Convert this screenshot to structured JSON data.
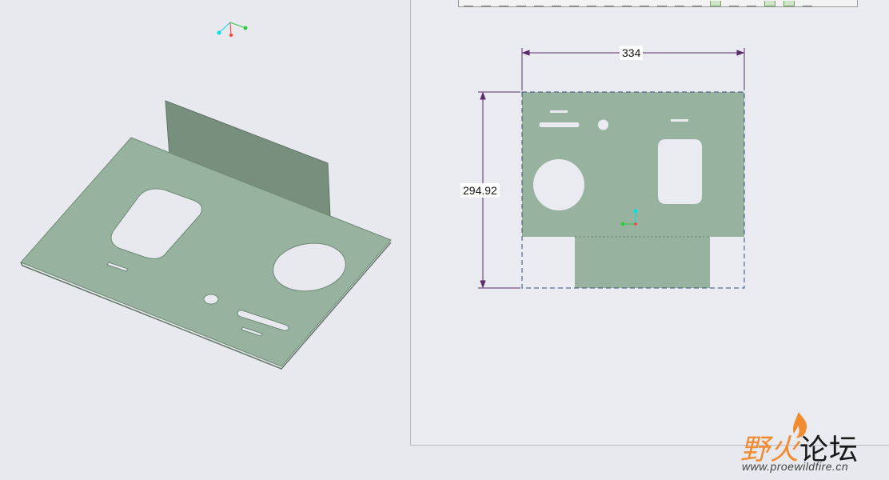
{
  "colors": {
    "background": "#e8e9ee",
    "sheet_face": "#97b29e",
    "sheet_wall": "#788f7e",
    "dimension_line": "#5a2d6b",
    "boundary_dash": "#2d4f7a",
    "csys_x": "#2ecc40",
    "csys_y": "#00e0e0",
    "csys_z": "#ff3b3b",
    "watermark_orange": "#f28a2e"
  },
  "model_view": {
    "name": "3d-sheetmetal-part",
    "coordinate_system_icon": "csys-triad-icon"
  },
  "flat_pattern": {
    "width_dimension": "334",
    "height_dimension": "294.92",
    "coordinate_system_icon": "csys-triad-icon"
  },
  "toolbar": {
    "buttons": [
      "tb-1",
      "tb-2",
      "tb-3",
      "tb-4",
      "tb-5",
      "tb-6",
      "tb-7",
      "tb-8",
      "tb-9",
      "tb-10",
      "tb-11",
      "tb-12",
      "tb-13",
      "tb-14",
      "tb-15",
      "tb-16",
      "tb-17",
      "tb-18",
      "tb-19",
      "tb-20"
    ]
  },
  "watermark": {
    "title_part1": "野火",
    "title_part2": "论坛",
    "url": "www.proewildfire.cn"
  }
}
